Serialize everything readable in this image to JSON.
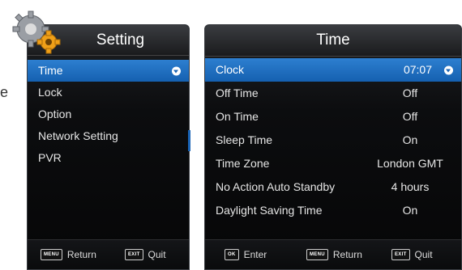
{
  "stray": {
    "text": "e"
  },
  "left_panel": {
    "title": "Setting",
    "items": [
      {
        "label": "Time",
        "selected": true
      },
      {
        "label": "Lock"
      },
      {
        "label": "Option"
      },
      {
        "label": "Network Setting"
      },
      {
        "label": "PVR"
      }
    ],
    "footer": {
      "return_key": "MENU",
      "return_label": "Return",
      "quit_key": "EXIT",
      "quit_label": "Quit"
    }
  },
  "right_panel": {
    "title": "Time",
    "rows": [
      {
        "label": "Clock",
        "value": "07:07",
        "selected": true
      },
      {
        "label": "Off Time",
        "value": "Off"
      },
      {
        "label": "On Time",
        "value": "Off"
      },
      {
        "label": "Sleep Time",
        "value": "On"
      },
      {
        "label": "Time Zone",
        "value": "London GMT"
      },
      {
        "label": "No Action Auto Standby",
        "value": "4 hours"
      },
      {
        "label": "Daylight Saving Time",
        "value": "On"
      }
    ],
    "footer": {
      "enter_key": "OK",
      "enter_label": "Enter",
      "return_key": "MENU",
      "return_label": "Return",
      "quit_key": "EXIT",
      "quit_label": "Quit"
    }
  },
  "colors": {
    "highlight": "#1b6cc0",
    "panel_bg": "#0b0c0e"
  },
  "icons": {
    "settings": "gear-icon",
    "selector": "arrow-icon"
  }
}
